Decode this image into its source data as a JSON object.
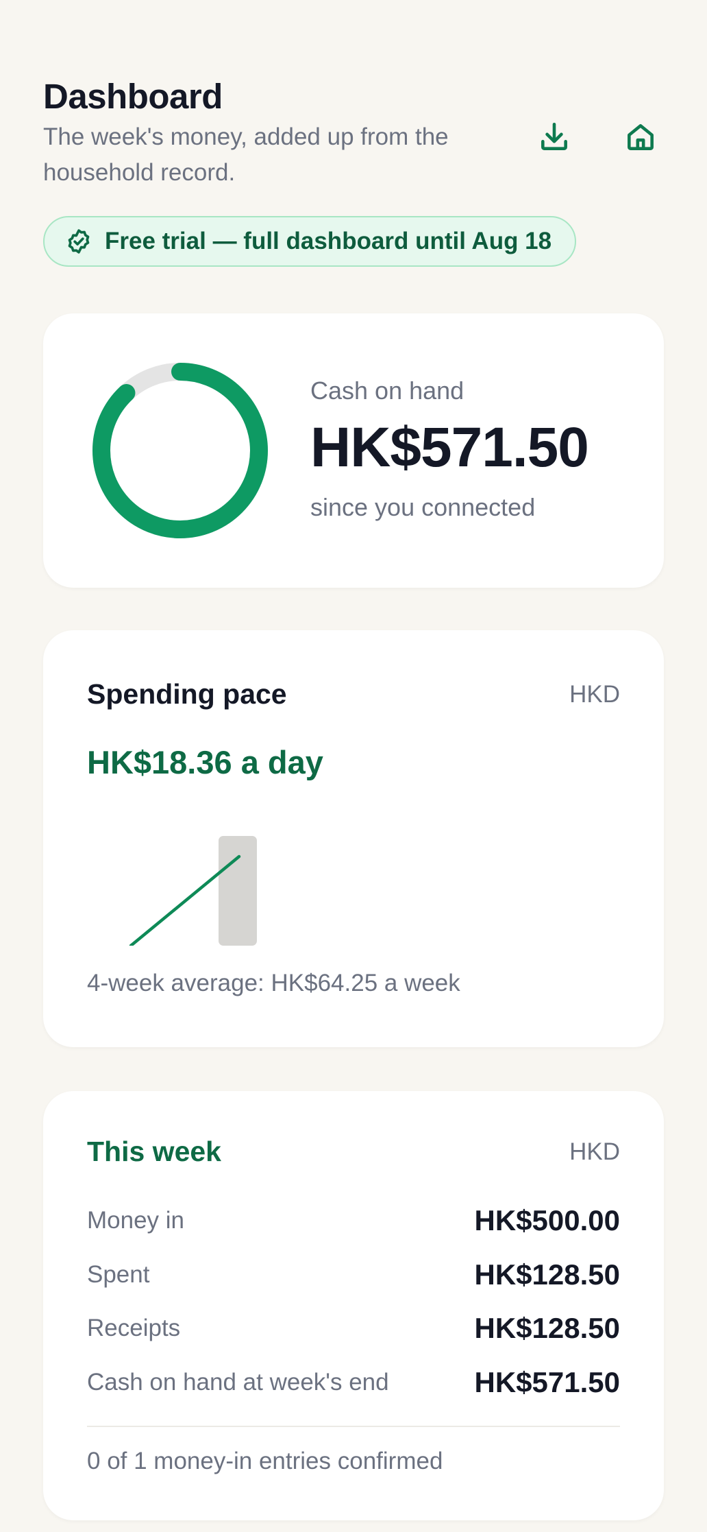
{
  "header": {
    "title": "Dashboard",
    "subtitle": "The week's money, added up from the household record.",
    "actions": [
      {
        "icon": "download-icon"
      },
      {
        "icon": "home-icon"
      }
    ]
  },
  "trial": {
    "icon": "badge-check-icon",
    "text": "Free trial — full dashboard until Aug 18"
  },
  "cash_card": {
    "label": "Cash on hand",
    "amount": "HK$571.50",
    "subtext": "since you connected",
    "ring_fraction": 0.88,
    "colors": {
      "ring": "#0e9a63",
      "track": "#e4e4e4"
    }
  },
  "pace_card": {
    "title": "Spending pace",
    "currency": "HKD",
    "rate": "HK$18.36 a day",
    "average": "4-week average: HK$64.25 a week",
    "colors": {
      "line": "#0e8a57",
      "bar": "#d6d5d2"
    }
  },
  "week_card": {
    "title": "This week",
    "currency": "HKD",
    "rows": [
      {
        "label": "Money in",
        "value": "HK$500.00"
      },
      {
        "label": "Spent",
        "value": "HK$128.50"
      },
      {
        "label": "Receipts",
        "value": "HK$128.50"
      },
      {
        "label": "Cash on hand at week's end",
        "value": "HK$571.50"
      }
    ],
    "confirm_note": "0 of 1 money-in entries confirmed"
  }
}
